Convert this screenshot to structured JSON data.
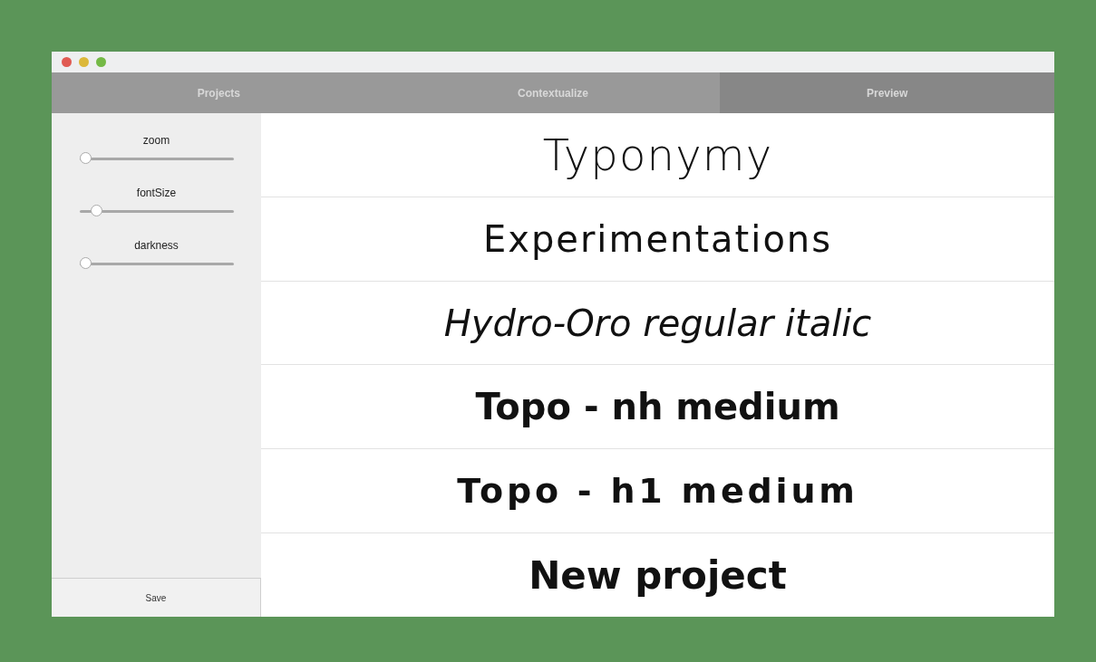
{
  "tabs": [
    {
      "label": "Projects",
      "selected": false
    },
    {
      "label": "Contextualize",
      "selected": false
    },
    {
      "label": "Preview",
      "selected": true
    }
  ],
  "sidebar": {
    "sliders": [
      {
        "label": "zoom",
        "level": 0
      },
      {
        "label": "fontSize",
        "level": 0.08
      },
      {
        "label": "darkness",
        "level": 0
      }
    ],
    "save_button": "Save"
  },
  "projects": [
    {
      "name": "Typonymy",
      "kind": "light"
    },
    {
      "name": "Experimentations",
      "kind": "regular"
    },
    {
      "name": "Hydro-Oro regular italic",
      "kind": "italic"
    },
    {
      "name": "Topo - nh medium",
      "kind": "bold"
    },
    {
      "name": "Topo - h1 medium",
      "kind": "wide"
    },
    {
      "name": "New project",
      "kind": "heavy"
    }
  ]
}
